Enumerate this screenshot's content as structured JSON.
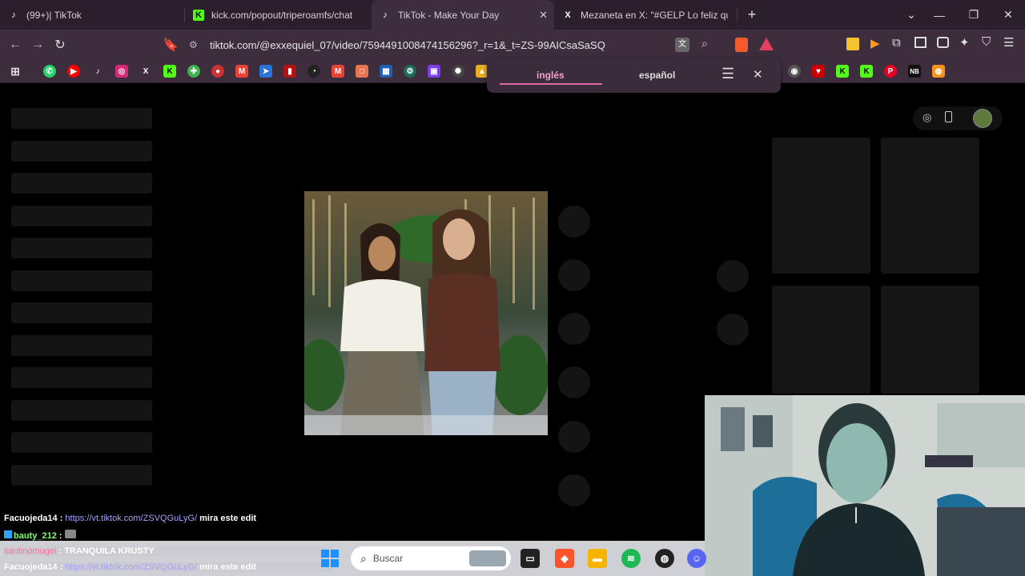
{
  "tabs": [
    {
      "title": "(99+)| TikTok",
      "icon": "tiktok-icon"
    },
    {
      "title": "kick.com/popout/triperoamfs/chat",
      "icon": "kick-icon"
    },
    {
      "title": "TikTok - Make Your Day",
      "icon": "tiktok-icon",
      "active": true
    },
    {
      "title": "Mezaneta en X: \"#GELP Lo feliz que f",
      "icon": "x-icon"
    }
  ],
  "address": {
    "url": "tiktok.com/@exxequiel_07/video/7594491008474156296?_r=1&_t=ZS-99AICsaSaSQ"
  },
  "translate_popup": {
    "source_lang": "inglés",
    "target_lang": "español"
  },
  "chat": [
    {
      "user": "Facuojeda14",
      "sep": " : ",
      "link": "https://vt.tiktok.com/ZSVQGuLyG/",
      "text": " mira este edit",
      "user_color": "#ffffff"
    },
    {
      "user": "bauty_212",
      "sep": " : ",
      "link": "",
      "text": "",
      "user_color": "#7cff6b"
    },
    {
      "user": "santinomugei",
      "sep": " : ",
      "link": "",
      "text": "TRANQUILA KRUSTY",
      "user_color": "#ff6fa0"
    },
    {
      "user": "Facuojeda14",
      "sep": " : ",
      "link": "https://vt.tiktok.com/ZSVQGuLyG/",
      "text": " mira este edit",
      "user_color": "#ffffff"
    }
  ],
  "taskbar": {
    "search_placeholder": "Buscar"
  },
  "colors": {
    "tab_bg": "#2b1f2b",
    "toolbar_bg": "#3d2d3d",
    "accent_pink": "#e16aa6"
  }
}
